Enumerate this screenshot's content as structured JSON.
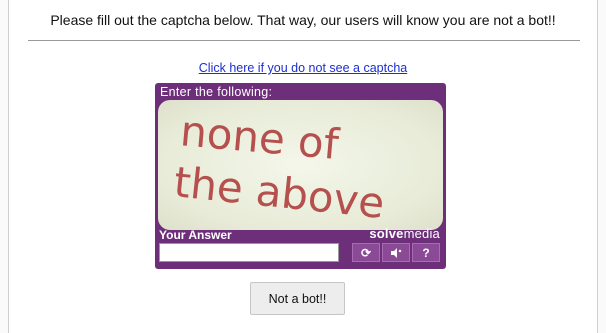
{
  "header": {
    "instructions": "Please fill out the captcha below. That way, our users will know you are not a bot!!"
  },
  "help_link": "Click here if you do not see a captcha",
  "captcha": {
    "prompt": "Enter the following:",
    "challenge_line1": "none of",
    "challenge_line2": "the above",
    "answer_label": "Your Answer",
    "answer_value": "",
    "brand_prefix": "solve",
    "brand_suffix": "media",
    "controls": {
      "refresh_icon": "refresh-icon",
      "audio_icon": "speaker-icon",
      "help_label": "?"
    },
    "text_color": "#b5504e",
    "frame_color": "#6e2f7a"
  },
  "submit_label": "Not a bot!!"
}
